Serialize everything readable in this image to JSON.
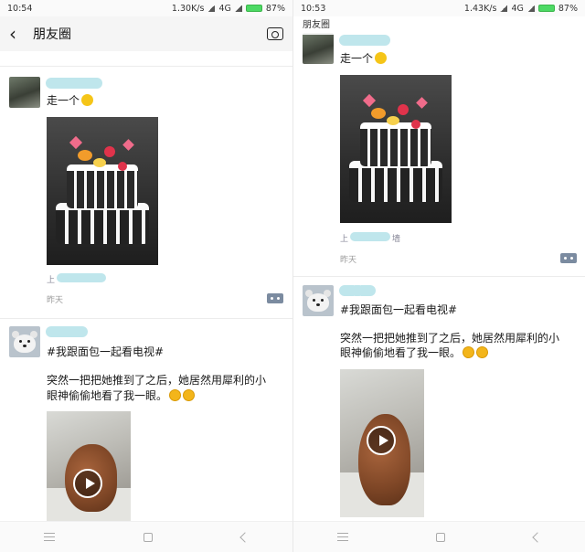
{
  "left": {
    "status": {
      "time": "10:54",
      "speed": "1.30K/s",
      "network": "4G",
      "battery": "87%"
    },
    "header": {
      "title": "朋友圈"
    },
    "post1": {
      "text": "走一个",
      "time": "昨天",
      "location_partial": "上"
    },
    "post2": {
      "hashtag": "#我跟面包一起看电视#",
      "body_line1": "突然一把把她推到了之后，她居然用犀利的小",
      "body_line2": "眼神偷偷地看了我一眼。"
    }
  },
  "right": {
    "status": {
      "time": "10:53",
      "speed": "1.43K/s",
      "network": "4G",
      "battery": "87%"
    },
    "header": {
      "title": "朋友圈"
    },
    "post1": {
      "text": "走一个",
      "time": "昨天",
      "location_partial": "上",
      "location_tail": "墙"
    },
    "post2": {
      "hashtag": "#我跟面包一起看电视#",
      "body_line1": "突然一把把她推到了之后，她居然用犀利的小",
      "body_line2": "眼神偷偷地看了我一眼。"
    }
  },
  "icons": {
    "back": "back-icon",
    "camera": "camera-icon",
    "comment": "comment-icon",
    "play": "play-icon",
    "nav_menu": "menu-icon",
    "nav_home": "home-icon",
    "nav_back": "back-nav-icon"
  },
  "colors": {
    "accent_battery": "#4cd964",
    "comment_button": "#7b8ba0"
  }
}
